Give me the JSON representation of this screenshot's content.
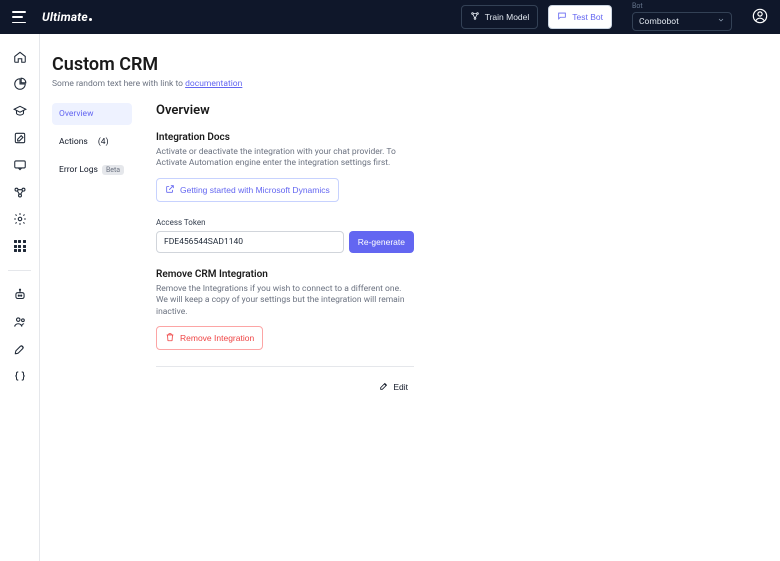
{
  "topbar": {
    "logo_text": "Ultimate",
    "train_label": "Train Model",
    "test_label": "Test Bot",
    "bot_label": "Bot",
    "bot_selected": "Combobot"
  },
  "page": {
    "title": "Custom CRM",
    "subtitle_prefix": "Some random text here with link to ",
    "subtitle_link": "documentation"
  },
  "subnav": {
    "overview": "Overview",
    "actions_label": "Actions",
    "actions_count": "(4)",
    "error_logs": "Error Logs",
    "error_logs_badge": "Beta"
  },
  "panel": {
    "heading": "Overview",
    "docs": {
      "title": "Integration Docs",
      "desc": "Activate or deactivate the integration with your chat provider. To Activate Automation engine enter the integration settings first.",
      "link_label": "Getting started with Microsoft Dynamics"
    },
    "token": {
      "label": "Access Token",
      "value": "FDE456544SAD1140",
      "button": "Re-generate"
    },
    "remove": {
      "title": "Remove CRM Integration",
      "desc": "Remove the Integrations if you wish to connect to a different one. We will keep a copy of your settings but the integration will remain inactive.",
      "button": "Remove Integration"
    },
    "edit_label": "Edit"
  }
}
